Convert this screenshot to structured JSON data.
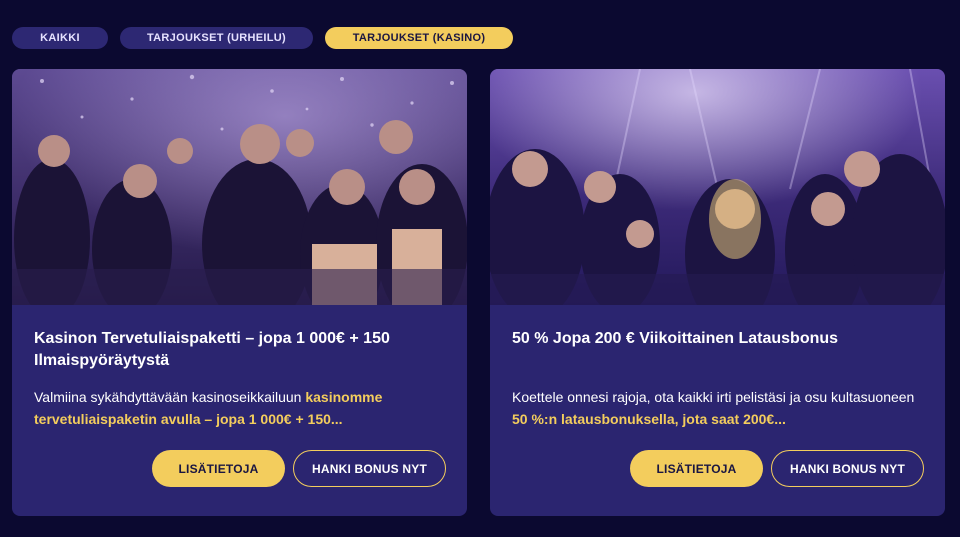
{
  "filters": [
    {
      "label": "KAIKKI",
      "active": false
    },
    {
      "label": "TARJOUKSET (URHEILU)",
      "active": false
    },
    {
      "label": "TARJOUKSET (KASINO)",
      "active": true
    }
  ],
  "colors": {
    "background": "#0b0930",
    "card": "#2b2570",
    "accent": "#f3cd5d",
    "pill": "#2d2873"
  },
  "cards": [
    {
      "title": "Kasinon Tervetuliaispaketti – jopa 1 000€ + 150 Ilmaispyöräytystä",
      "desc_plain": "Valmiina sykähdyttävään kasinoseikkailuun ",
      "desc_highlight": "kasinomme tervetuliaispaketin avulla – jopa 1 000€ + 150...",
      "image_alt": "party crowd photo",
      "primary_label": "LISÄTIETOJA",
      "secondary_label": "HANKI BONUS NYT"
    },
    {
      "title": "50 % Jopa 200 € Viikoittainen Latausbonus",
      "desc_plain": "Koettele onnesi rajoja, ota kaikki irti pelistäsi ja osu kultasuoneen ",
      "desc_highlight": "50 %:n latausbonuksella, jota saat 200€...",
      "image_alt": "nightclub dancing photo",
      "primary_label": "LISÄTIETOJA",
      "secondary_label": "HANKI BONUS NYT"
    }
  ]
}
